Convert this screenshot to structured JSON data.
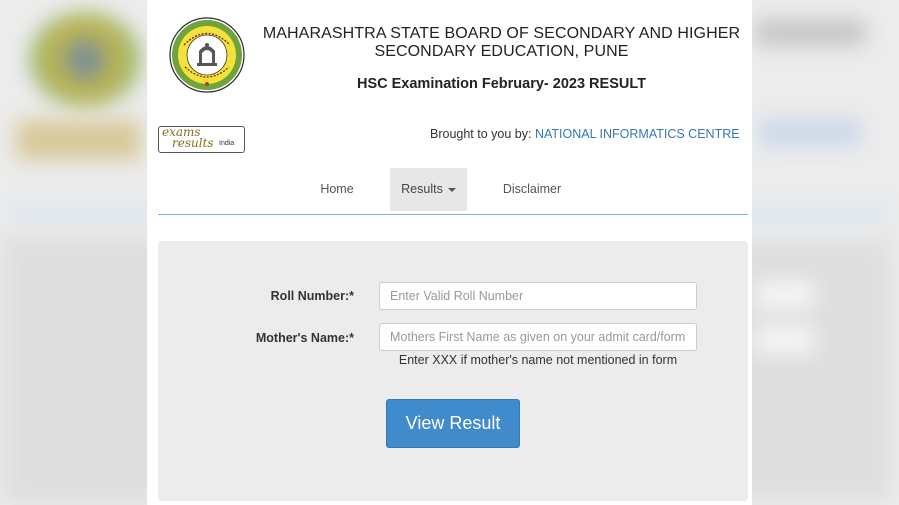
{
  "header": {
    "board_name": "MAHARASHTRA STATE BOARD OF SECONDARY AND HIGHER SECONDARY EDUCATION, PUNE",
    "exam_title": "HSC Examination February- 2023 RESULT",
    "logo_icon": "maharashtra-board-seal-icon"
  },
  "partner": {
    "logo_line1": "exams",
    "logo_line2": "results",
    "logo_line3": "India",
    "brought_prefix": "Brought to you by: ",
    "brought_org": "NATIONAL INFORMATICS CENTRE"
  },
  "nav": {
    "home": "Home",
    "results": "Results",
    "disclaimer": "Disclaimer"
  },
  "form": {
    "roll_label": "Roll Number:*",
    "roll_placeholder": "Enter Valid Roll Number",
    "mother_label": "Mother's Name:*",
    "mother_placeholder": "Mothers First Name as given on your admit card/form",
    "mother_hint": "Enter XXX if mother's name not mentioned in form",
    "submit_label": "View Result"
  },
  "colors": {
    "link_blue": "#3877b6",
    "button_blue": "#3f8bcc",
    "panel_gray": "#ececec"
  }
}
